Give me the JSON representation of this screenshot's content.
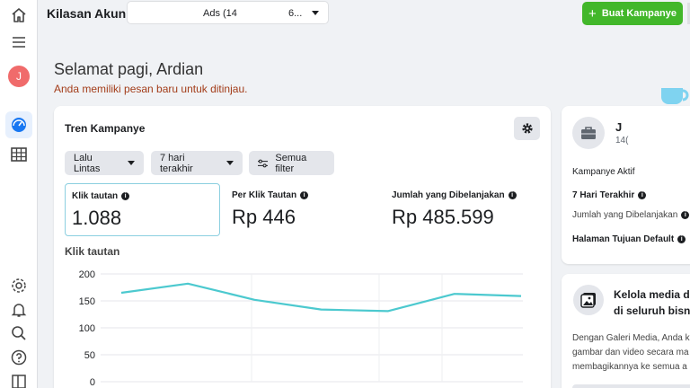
{
  "header": {
    "title": "Kilasan Akun",
    "account_select_left": "Ads (14",
    "account_select_right": "6...",
    "create_button": "Buat Kampanye"
  },
  "greeting": {
    "title": "Selamat pagi, Ardian",
    "subtitle": "Anda memiliki pesan baru untuk ditinjau."
  },
  "user": {
    "avatar_initial": "J"
  },
  "trend_card": {
    "title": "Tren Kampanye",
    "filters": [
      {
        "label": "Lalu Lintas"
      },
      {
        "label": "7 hari terakhir"
      },
      {
        "label": "Semua filter"
      }
    ],
    "metrics": [
      {
        "label": "Klik tautan",
        "value": "1.088"
      },
      {
        "label": "Per Klik Tautan",
        "value": "Rp 446"
      },
      {
        "label": "Jumlah yang Dibelanjakan",
        "value": "Rp 485.599"
      }
    ],
    "chart_label": "Klik tautan"
  },
  "chart_data": {
    "type": "line",
    "title": "Klik tautan",
    "y_ticks": [
      "200",
      "150",
      "100",
      "50",
      "0"
    ],
    "ylim": [
      0,
      200
    ],
    "series": [
      {
        "values": [
          165,
          182,
          152,
          134,
          131,
          163,
          159
        ]
      }
    ],
    "grid": true,
    "color": "#4cc9cf"
  },
  "account_card": {
    "name": "J",
    "id": "14(",
    "lines": [
      {
        "text": "Kampanye Aktif",
        "style": "normal"
      },
      {
        "text": "7 Hari Terakhir",
        "style": "bold"
      },
      {
        "text": "Jumlah yang Dibelanjakan",
        "style": "gray"
      },
      {
        "text": "Halaman Tujuan Default",
        "style": "bold"
      }
    ]
  },
  "media_card": {
    "title_line1": "Kelola media d",
    "title_line2": "di seluruh bisn",
    "desc_line1": "Dengan Galeri Media, Anda k",
    "desc_line2": "gambar dan video secara ma",
    "desc_line3": "membagikannya ke semua a"
  },
  "colors": {
    "accent_green": "#42b72a",
    "line_teal": "#4cc9cf",
    "subtitle_red": "#a33d1a"
  }
}
